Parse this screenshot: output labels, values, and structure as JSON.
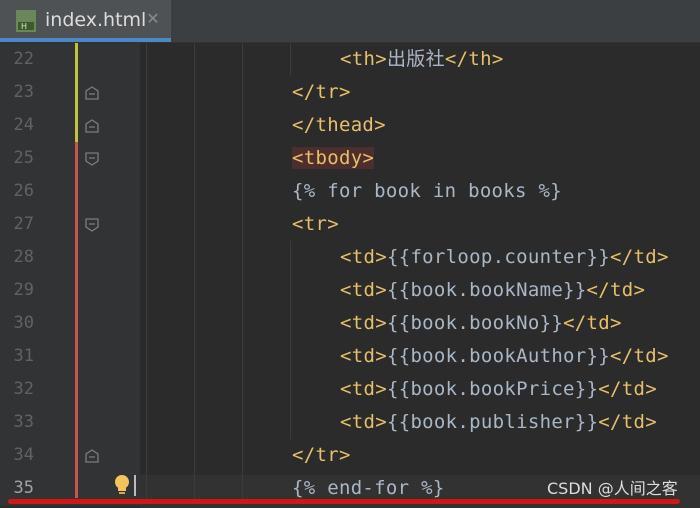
{
  "tab": {
    "filename": "index.html",
    "icon": "html-file-icon",
    "close": "✕"
  },
  "lines": [
    {
      "n": "22",
      "parts": [
        {
          "t": "<th>",
          "c": "tag"
        },
        {
          "t": "出版社",
          "c": "txt cjk"
        },
        {
          "t": "</th>",
          "c": "tag"
        }
      ]
    },
    {
      "n": "23",
      "parts": [
        {
          "t": "</tr>",
          "c": "tag"
        }
      ]
    },
    {
      "n": "24",
      "parts": [
        {
          "t": "</thead>",
          "c": "tag"
        }
      ]
    },
    {
      "n": "25",
      "parts": [
        {
          "t": "<tbody>",
          "c": "tag tbody-hl"
        }
      ]
    },
    {
      "n": "26",
      "parts": [
        {
          "t": "{% for book in books %}",
          "c": "tpl"
        }
      ]
    },
    {
      "n": "27",
      "parts": [
        {
          "t": "<tr>",
          "c": "tag"
        }
      ]
    },
    {
      "n": "28",
      "parts": [
        {
          "t": "<td>",
          "c": "tag"
        },
        {
          "t": "{{forloop.counter}}",
          "c": "tpl"
        },
        {
          "t": "</td>",
          "c": "tag"
        }
      ]
    },
    {
      "n": "29",
      "parts": [
        {
          "t": "<td>",
          "c": "tag"
        },
        {
          "t": "{{book.bookName}}",
          "c": "tpl"
        },
        {
          "t": "</td>",
          "c": "tag"
        }
      ]
    },
    {
      "n": "30",
      "parts": [
        {
          "t": "<td>",
          "c": "tag"
        },
        {
          "t": "{{book.bookNo}}",
          "c": "tpl"
        },
        {
          "t": "</td>",
          "c": "tag"
        }
      ]
    },
    {
      "n": "31",
      "parts": [
        {
          "t": "<td>",
          "c": "tag"
        },
        {
          "t": "{{book.bookAuthor}}",
          "c": "tpl"
        },
        {
          "t": "</td>",
          "c": "tag"
        }
      ]
    },
    {
      "n": "32",
      "parts": [
        {
          "t": "<td>",
          "c": "tag"
        },
        {
          "t": "{{book.bookPrice}}",
          "c": "tpl"
        },
        {
          "t": "</td>",
          "c": "tag"
        }
      ]
    },
    {
      "n": "33",
      "parts": [
        {
          "t": "<td>",
          "c": "tag"
        },
        {
          "t": "{{book.publisher}}",
          "c": "tpl"
        },
        {
          "t": "</td>",
          "c": "tag"
        }
      ]
    },
    {
      "n": "34",
      "parts": [
        {
          "t": "</tr>",
          "c": "tag"
        }
      ]
    },
    {
      "n": "35",
      "parts": [
        {
          "t": "{% end-for %}",
          "c": "tpl"
        }
      ]
    }
  ],
  "current_line": "35",
  "watermark": "CSDN @人间之客",
  "colors": {
    "tag": "#e8bf6a",
    "text": "#a9b7c6",
    "vcs_modified": "#c2c23e",
    "vcs_changed": "#c75450",
    "error_underline": "#d21515"
  }
}
